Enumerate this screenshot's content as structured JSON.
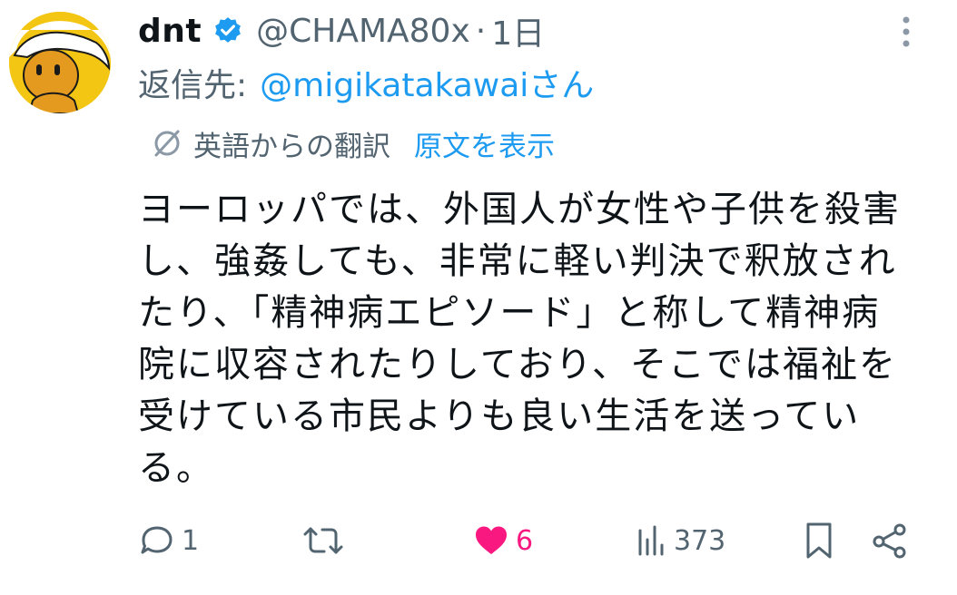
{
  "tweet": {
    "author": {
      "display_name": "dnt",
      "handle": "@CHAMA80x",
      "verified_icon": "verified-badge-icon",
      "avatar": "yellow-cartoon-avatar"
    },
    "separator": "·",
    "time": "1日",
    "reply": {
      "prefix": "返信先:",
      "target": "@migikatakawaiさん"
    },
    "translation": {
      "icon": "translate-icon",
      "label": "英語からの翻訳",
      "show_original": "原文を表示"
    },
    "text_lines": [
      "ヨーロッパでは、外国人が女性や子供を殺害",
      "し、強姦しても、非常に軽い判決で釈放され",
      "たり、「精神病エピソード」と称して精神病",
      "院に収容されたりしており、そこでは福祉を",
      "受けている市民よりも良い生活を送ってい",
      "る。"
    ],
    "actions": {
      "reply_count": "1",
      "retweet_count": "",
      "like_count": "6",
      "views_count": "373"
    }
  },
  "colors": {
    "accent": "#1d9bf0",
    "secondary_text": "#536471",
    "like": "#f91880",
    "avatar_bg": "#f3c614"
  }
}
